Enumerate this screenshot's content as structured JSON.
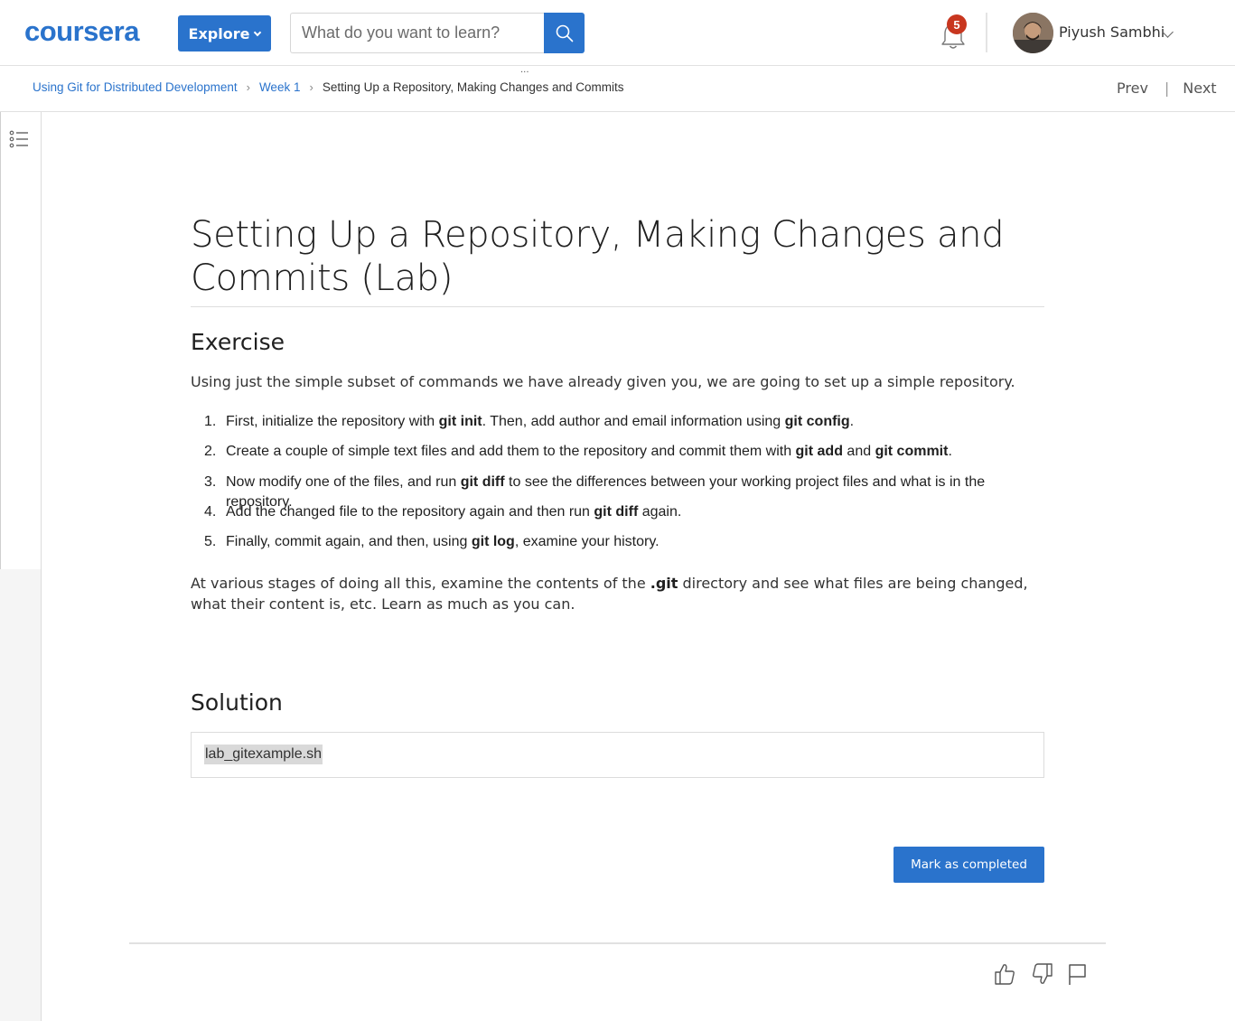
{
  "header": {
    "logo_text": "coursera",
    "explore_label": "Explore",
    "search_placeholder": "What do you want to learn?",
    "notification_count": "5",
    "user_name": "Piyush Sambhi",
    "overflow_dots": "..."
  },
  "breadcrumb": {
    "course": "Using Git for Distributed Development",
    "week": "Week 1",
    "current": "Setting Up a Repository, Making Changes and Commits",
    "separator": "›"
  },
  "nav": {
    "prev": "Prev",
    "divider": "|",
    "next": "Next"
  },
  "main": {
    "title": "Setting Up a Repository, Making Changes and Commits (Lab)",
    "exercise_heading": "Exercise",
    "intro": "Using just the simple subset of commands we have already given you, we are going to set up a simple repository.",
    "steps": [
      {
        "num": "1.",
        "parts": [
          "First, initialize the repository with ",
          "git init",
          ". Then, add author and email information using ",
          "git config",
          "."
        ]
      },
      {
        "num": "2.",
        "parts": [
          "Create a couple of simple text files and add them to the repository and commit them with ",
          "git add",
          " and ",
          "git commit",
          "."
        ]
      },
      {
        "num": "3.",
        "parts": [
          "Now modify one of the files, and run ",
          "git diff",
          " to see the differences between your working project files and what is in the repository."
        ]
      },
      {
        "num": "4.",
        "parts": [
          "Add the changed file to the repository again and then run ",
          "git diff",
          " again."
        ]
      },
      {
        "num": "5.",
        "parts": [
          "Finally, commit again, and then, using ",
          "git log",
          ", examine your history."
        ]
      }
    ],
    "outro_before": "At various stages of doing all this, examine the contents of the ",
    "outro_bold": ".git",
    "outro_after": " directory and see what files are being changed, what their content is, etc. Learn as much as you can.",
    "solution_heading": "Solution",
    "solution_file": "lab_gitexample.sh",
    "mark_completed_label": "Mark as completed"
  },
  "colors": {
    "brand_blue": "#2a73cc",
    "badge_red": "#c8361f"
  },
  "icons": {
    "search": "search-icon",
    "bell": "bell-icon",
    "toc": "list-icon",
    "like": "thumbs-up-icon",
    "dislike": "thumbs-down-icon",
    "flag": "flag-icon"
  }
}
